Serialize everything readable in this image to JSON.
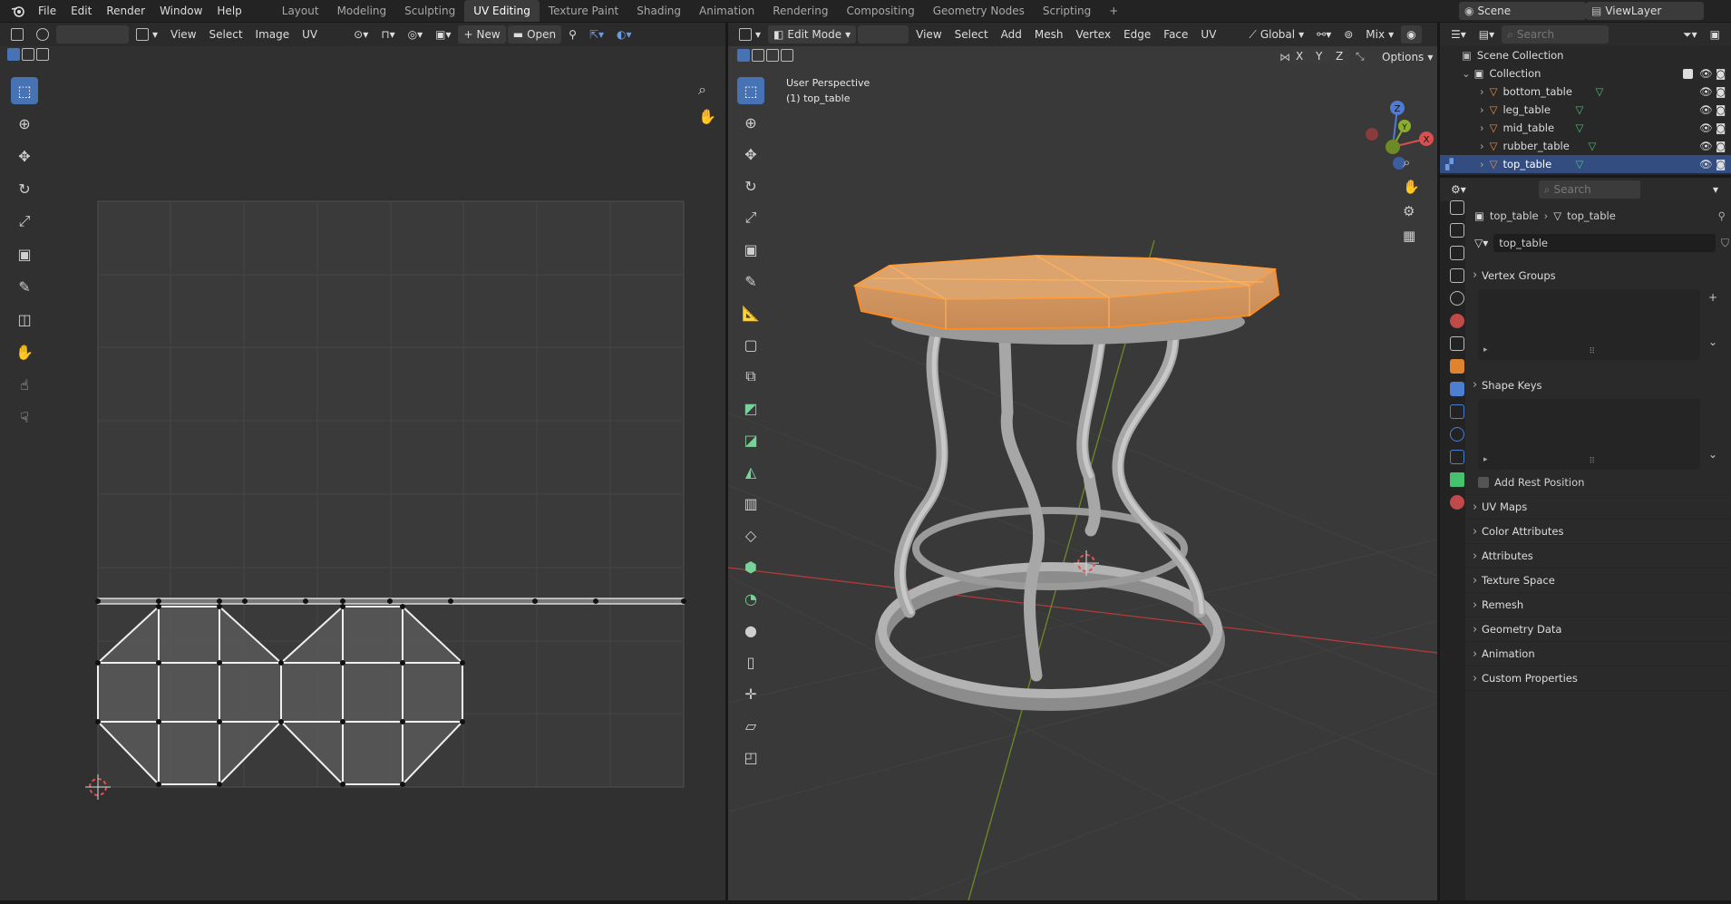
{
  "topbar": {
    "menus": [
      "File",
      "Edit",
      "Render",
      "Window",
      "Help"
    ],
    "workspaces": [
      "Layout",
      "Modeling",
      "Sculpting",
      "UV Editing",
      "Texture Paint",
      "Shading",
      "Animation",
      "Rendering",
      "Compositing",
      "Geometry Nodes",
      "Scripting"
    ],
    "active_workspace": "UV Editing",
    "scene": "Scene",
    "view_layer": "ViewLayer",
    "add_tab": "+"
  },
  "uv_editor": {
    "menus": [
      "View",
      "Select",
      "Image",
      "UV"
    ],
    "new_label": "New",
    "open_label": "Open"
  },
  "viewport": {
    "mode": "Edit Mode",
    "menus": [
      "View",
      "Select",
      "Add",
      "Mesh",
      "Vertex",
      "Edge",
      "Face",
      "UV"
    ],
    "orientation": "Global",
    "overlay_mode": "Mix",
    "options_label": "Options",
    "axis_x": "X",
    "axis_y": "Y",
    "axis_z": "Z",
    "perspective_label": "User Perspective",
    "object_label": "(1) top_table",
    "gizmo": {
      "x": "X",
      "y": "Y",
      "z": "Z"
    }
  },
  "outliner": {
    "search_placeholder": "Search",
    "scene_collection": "Scene Collection",
    "collection": "Collection",
    "items": [
      "bottom_table",
      "leg_table",
      "mid_table",
      "rubber_table",
      "top_table"
    ],
    "selected": "top_table"
  },
  "properties": {
    "search_placeholder": "Search",
    "breadcrumb_object": "top_table",
    "breadcrumb_mesh": "top_table",
    "mesh_name": "top_table",
    "vertex_groups": "Vertex Groups",
    "shape_keys": "Shape Keys",
    "add_rest_position": "Add Rest Position",
    "collapsed_sections": [
      "UV Maps",
      "Color Attributes",
      "Attributes",
      "Texture Space",
      "Remesh",
      "Geometry Data",
      "Animation",
      "Custom Properties"
    ]
  },
  "colors": {
    "accent_blue": "#4772b3",
    "selection_orange": "#ff8a1c",
    "mesh_green": "#45c26f",
    "axis_red": "#c24040",
    "axis_green": "#7a9a2a"
  }
}
